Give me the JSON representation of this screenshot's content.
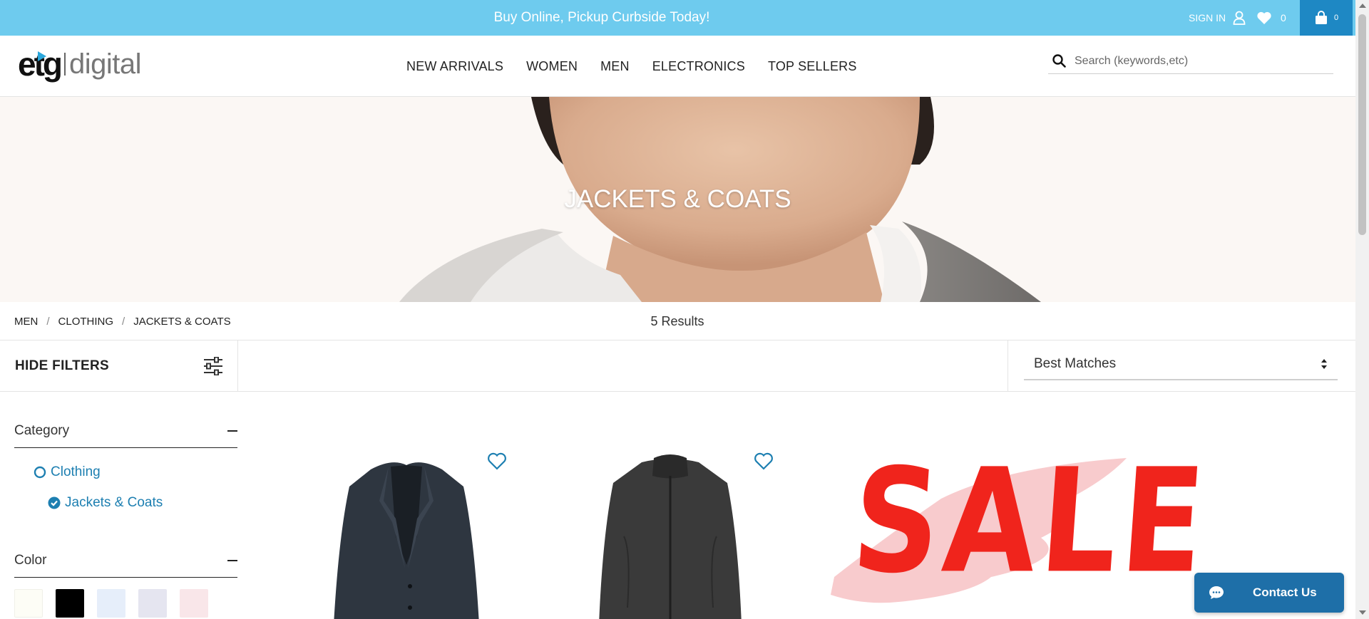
{
  "promo": {
    "text": "Buy Online, Pickup Curbside Today!",
    "sign_in": "SIGN IN",
    "wishlist_count": "0",
    "cart_count": "0"
  },
  "logo": {
    "etg": "etg",
    "digital": "digital"
  },
  "nav": {
    "items": [
      "NEW ARRIVALS",
      "WOMEN",
      "MEN",
      "ELECTRONICS",
      "TOP SELLERS"
    ]
  },
  "search": {
    "placeholder": "Search (keywords,etc)"
  },
  "hero": {
    "title": "JACKETS & COATS"
  },
  "breadcrumb": {
    "items": [
      "MEN",
      "CLOTHING",
      "JACKETS & COATS"
    ],
    "separator": "/"
  },
  "results": {
    "text": "5 Results"
  },
  "filters": {
    "hide_label": "HIDE FILTERS"
  },
  "sort": {
    "selected": "Best Matches"
  },
  "sidebar": {
    "category_title": "Category",
    "categories": [
      {
        "label": "Clothing",
        "state": "unselected"
      },
      {
        "label": "Jackets & Coats",
        "state": "selected"
      }
    ],
    "color_title": "Color",
    "swatch_colors": [
      "#fdfdf6",
      "#000000",
      "#e6eefa",
      "#e5e5f0",
      "#f9e6e9"
    ]
  },
  "products": {
    "sale_text": "SALE"
  },
  "contact": {
    "label": "Contact Us"
  },
  "colors": {
    "promo_bg": "#6ecbee",
    "cart_bg": "#1e88c4",
    "link": "#1d7fb1",
    "contact_bg": "#1e6fa8",
    "sale_red": "#f0241c",
    "sale_pink": "#f7c5c8"
  }
}
